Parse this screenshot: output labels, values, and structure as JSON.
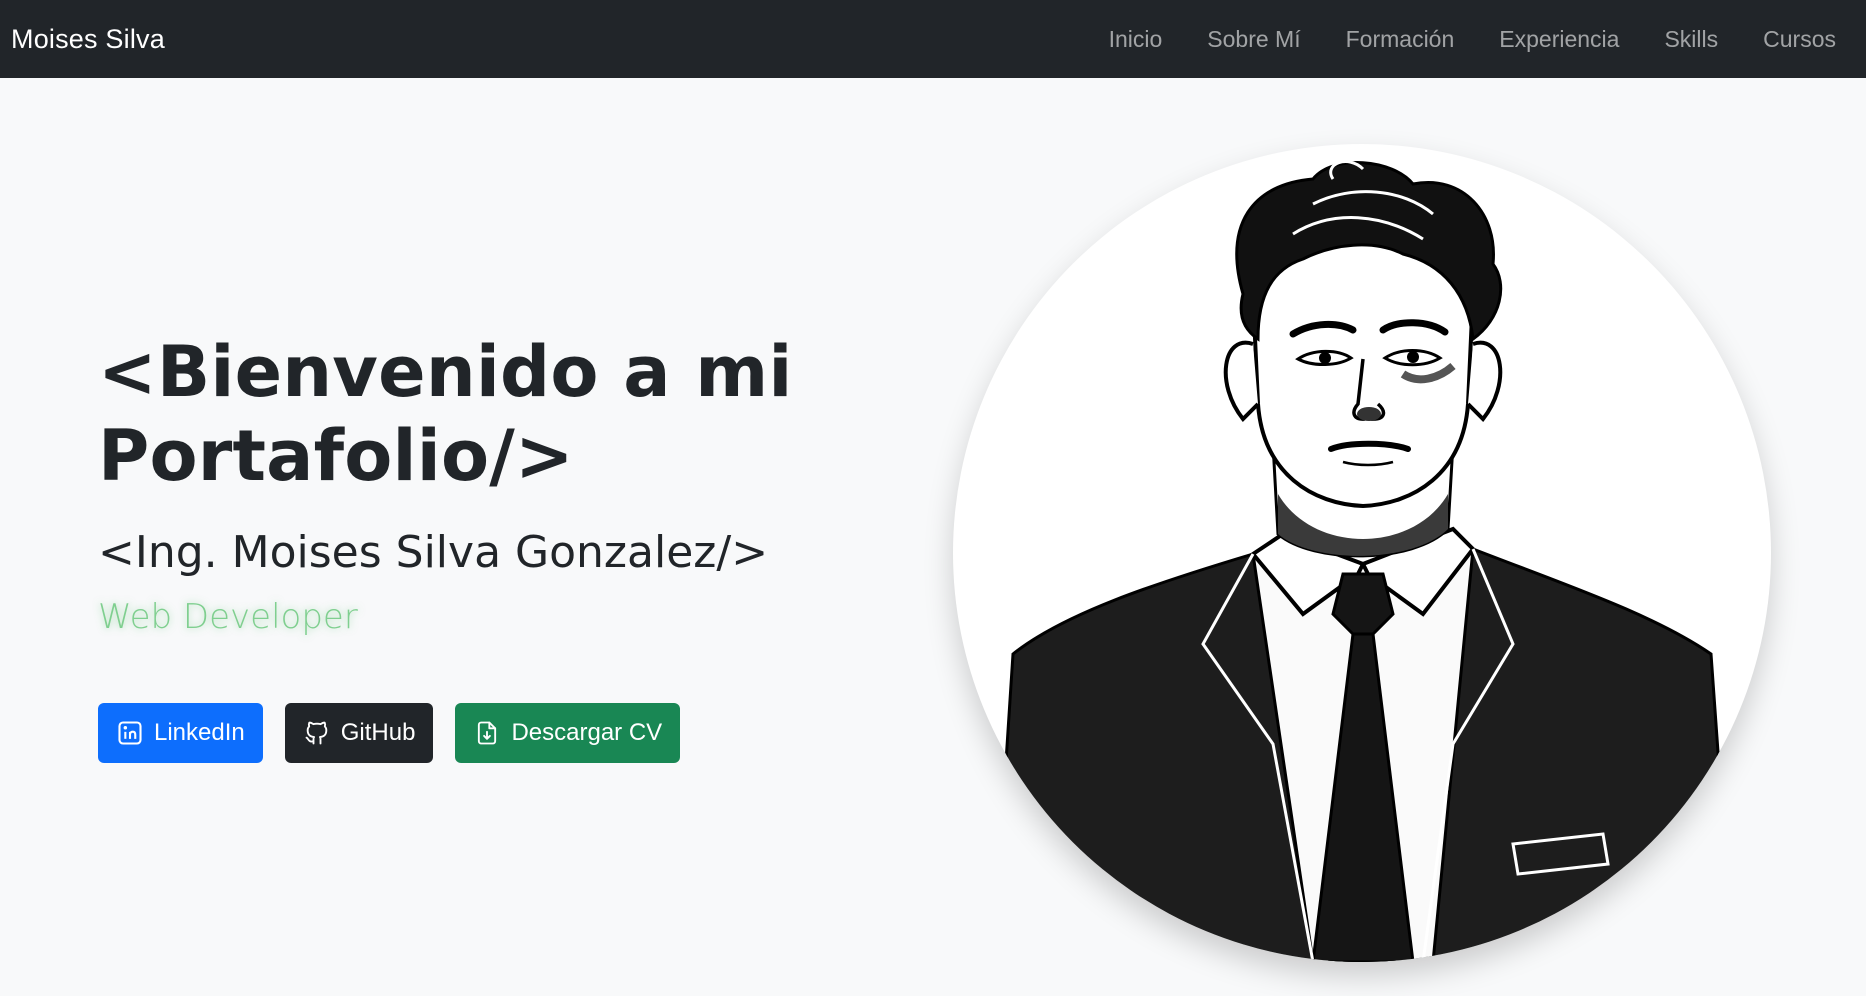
{
  "navbar": {
    "brand": "Moises Silva",
    "links": [
      "Inicio",
      "Sobre Mí",
      "Formación",
      "Experiencia",
      "Skills",
      "Cursos"
    ]
  },
  "hero": {
    "title_line1": "<Bienvenido a mi",
    "title_line2": "Portafolio/>",
    "subtitle": "<Ing. Moises Silva Gonzalez/>",
    "role": "Web Developer"
  },
  "buttons": {
    "linkedin": {
      "label": "LinkedIn",
      "icon": "linkedin-icon",
      "color": "#0d6efd"
    },
    "github": {
      "label": "GitHub",
      "icon": "github-icon",
      "color": "#212529"
    },
    "cv": {
      "label": "Descargar CV",
      "icon": "file-download-icon",
      "color": "#198754"
    }
  },
  "colors": {
    "navbar_bg": "#212529",
    "page_bg": "#f8f9fa",
    "role_text": "#7fcf8f"
  }
}
